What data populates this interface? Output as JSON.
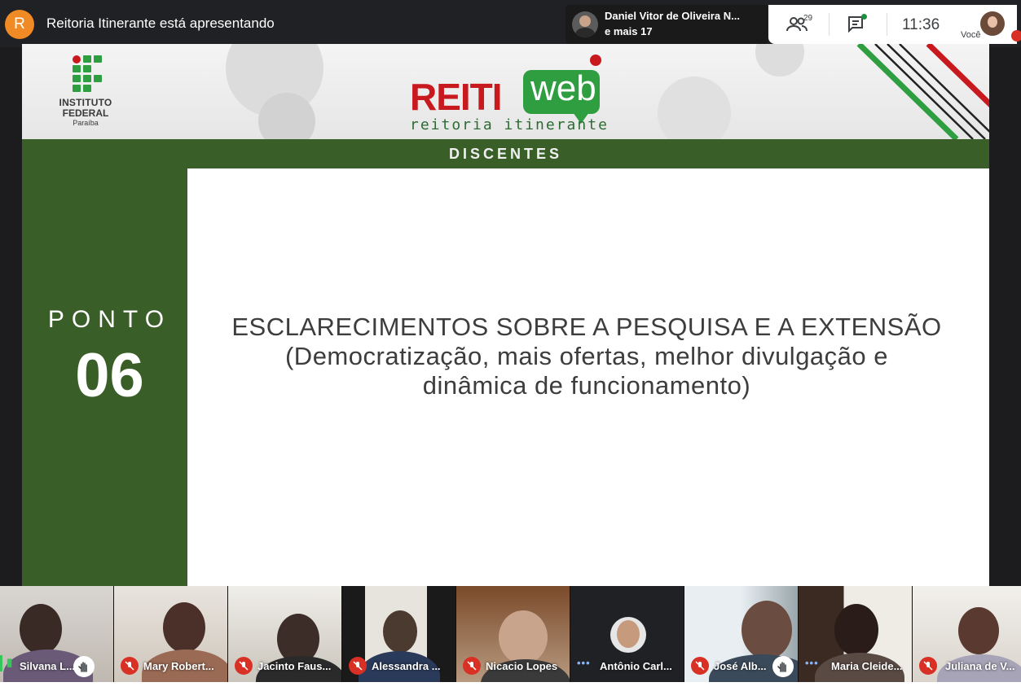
{
  "topbar": {
    "presenter_initial": "R",
    "presenting_text": "Reitoria Itinerante está apresentando",
    "speaker_name": "Daniel Vitor de Oliveira N...",
    "speaker_more": "e mais 17",
    "people_count": "29",
    "clock": "11:36",
    "self_label": "Você"
  },
  "slide": {
    "if_logo_line1": "INSTITUTO",
    "if_logo_line2": "FEDERAL",
    "if_logo_line3": "Paraíba",
    "brand_word": "REITI",
    "brand_web": "web",
    "brand_sub": "reitoria itinerante",
    "section_title": "DISCENTES",
    "ponto_label": "PONTO",
    "ponto_number": "06",
    "text_line1": "ESCLARECIMENTOS SOBRE A PESQUISA E A EXTENSÃO",
    "text_line2": "(Democratização, mais ofertas, melhor divulgação e",
    "text_line3": "dinâmica de funcionamento)"
  },
  "participants": [
    {
      "name": "Silvana L...",
      "status": "speaking",
      "hand": true
    },
    {
      "name": "Mary Robert...",
      "status": "muted",
      "hand": false
    },
    {
      "name": "Jacinto Faus...",
      "status": "muted",
      "hand": false
    },
    {
      "name": "Alessandra ...",
      "status": "muted",
      "hand": false
    },
    {
      "name": "Nicacio Lopes",
      "status": "muted",
      "hand": false
    },
    {
      "name": "Antônio Carl...",
      "status": "dots",
      "hand": false
    },
    {
      "name": "José Alb...",
      "status": "muted",
      "hand": true
    },
    {
      "name": "Maria Cleide...",
      "status": "dots",
      "hand": false
    },
    {
      "name": "Juliana de V...",
      "status": "muted",
      "hand": false
    }
  ],
  "colors": {
    "slide_green": "#3a5e27",
    "brand_red": "#c8191e",
    "brand_green": "#2f9e41",
    "mute_red": "#d93025"
  }
}
